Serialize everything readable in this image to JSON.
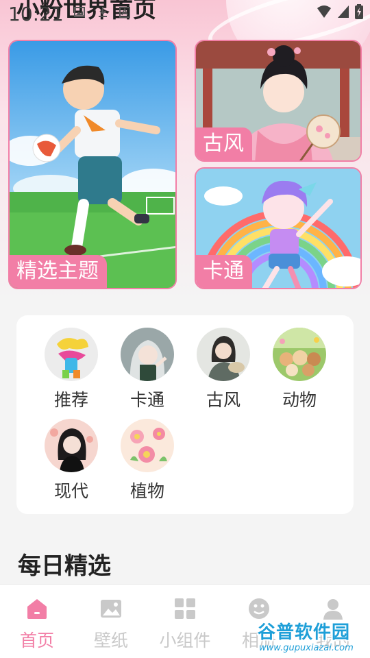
{
  "status_bar": {
    "time": "10:21"
  },
  "header": {
    "title": "小粉世界首页"
  },
  "banners": [
    {
      "label": "精选主题",
      "image": "boy-playing-soccer-illustration"
    },
    {
      "label": "古风",
      "image": "ancient-style-girl-illustration"
    },
    {
      "label": "卡通",
      "image": "cartoon-rainbow-girl-illustration"
    }
  ],
  "categories": [
    {
      "label": "推荐",
      "icon": "graffiti-character-avatar"
    },
    {
      "label": "卡通",
      "icon": "anime-girl-avatar"
    },
    {
      "label": "古风",
      "icon": "ancient-girl-avatar"
    },
    {
      "label": "动物",
      "icon": "animals-group-avatar"
    },
    {
      "label": "现代",
      "icon": "modern-woman-avatar"
    },
    {
      "label": "植物",
      "icon": "flowers-avatar"
    }
  ],
  "daily": {
    "title": "每日精选"
  },
  "bottom_nav": [
    {
      "label": "首页",
      "icon": "home-icon",
      "active": true
    },
    {
      "label": "壁纸",
      "icon": "image-icon",
      "active": false
    },
    {
      "label": "小组件",
      "icon": "widgets-grid-icon",
      "active": false
    },
    {
      "label": "相册",
      "icon": "emoji-face-icon",
      "active": false
    },
    {
      "label": "我的",
      "icon": "user-icon",
      "active": false
    }
  ],
  "watermark": {
    "text": "谷普软件园",
    "url": "www.gupuxiazai.com"
  },
  "colors": {
    "accent": "#f27ea6",
    "inactive": "#c9c9c9"
  }
}
